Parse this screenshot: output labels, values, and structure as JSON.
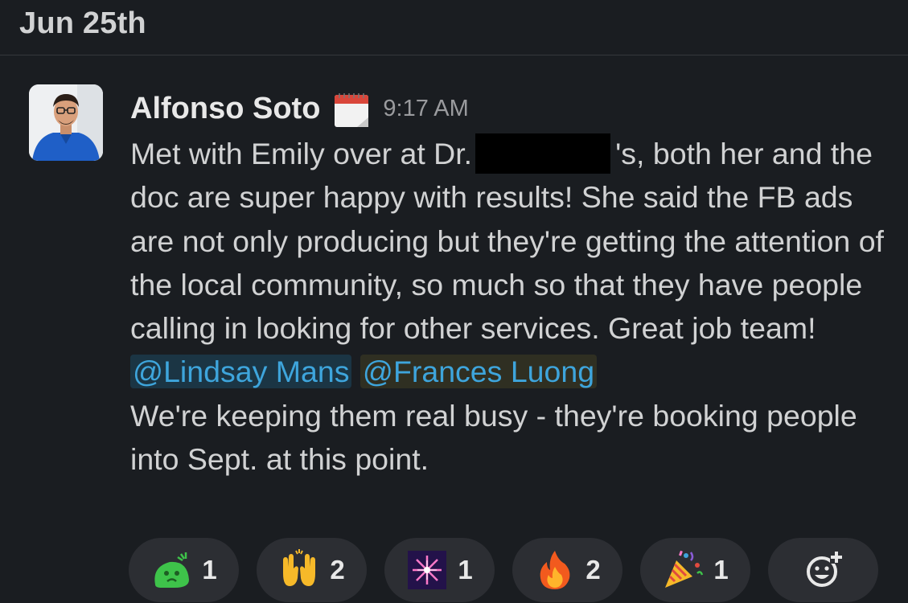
{
  "date_header": "Jun 25th",
  "message": {
    "author": "Alfonso Soto",
    "status_icon": "calendar-icon",
    "time": "9:17 AM",
    "text_parts": {
      "p1": "Met with Emily over at Dr.",
      "p2": "'s, both her and the doc are super happy with results! She said the FB ads are not only producing but they're getting the attention of the local community, so much so that they have people calling in looking for other services. Great job team!",
      "p3": "We're keeping them real busy - they're booking people into Sept. at this point."
    },
    "mentions": [
      "@Lindsay Mans",
      "@Frances Luong"
    ]
  },
  "reactions": [
    {
      "icon": "green-blob-emoji",
      "count": "1"
    },
    {
      "icon": "raised-hands-emoji",
      "count": "2"
    },
    {
      "icon": "fireworks-emoji",
      "count": "1"
    },
    {
      "icon": "fire-emoji",
      "count": "2"
    },
    {
      "icon": "party-popper-emoji",
      "count": "1"
    }
  ],
  "add_reaction_icon": "add-reaction-icon",
  "colors": {
    "background": "#1a1d21",
    "text": "#d1d2d3",
    "mention": "#3ea5dc",
    "pill": "#2c2e33"
  }
}
